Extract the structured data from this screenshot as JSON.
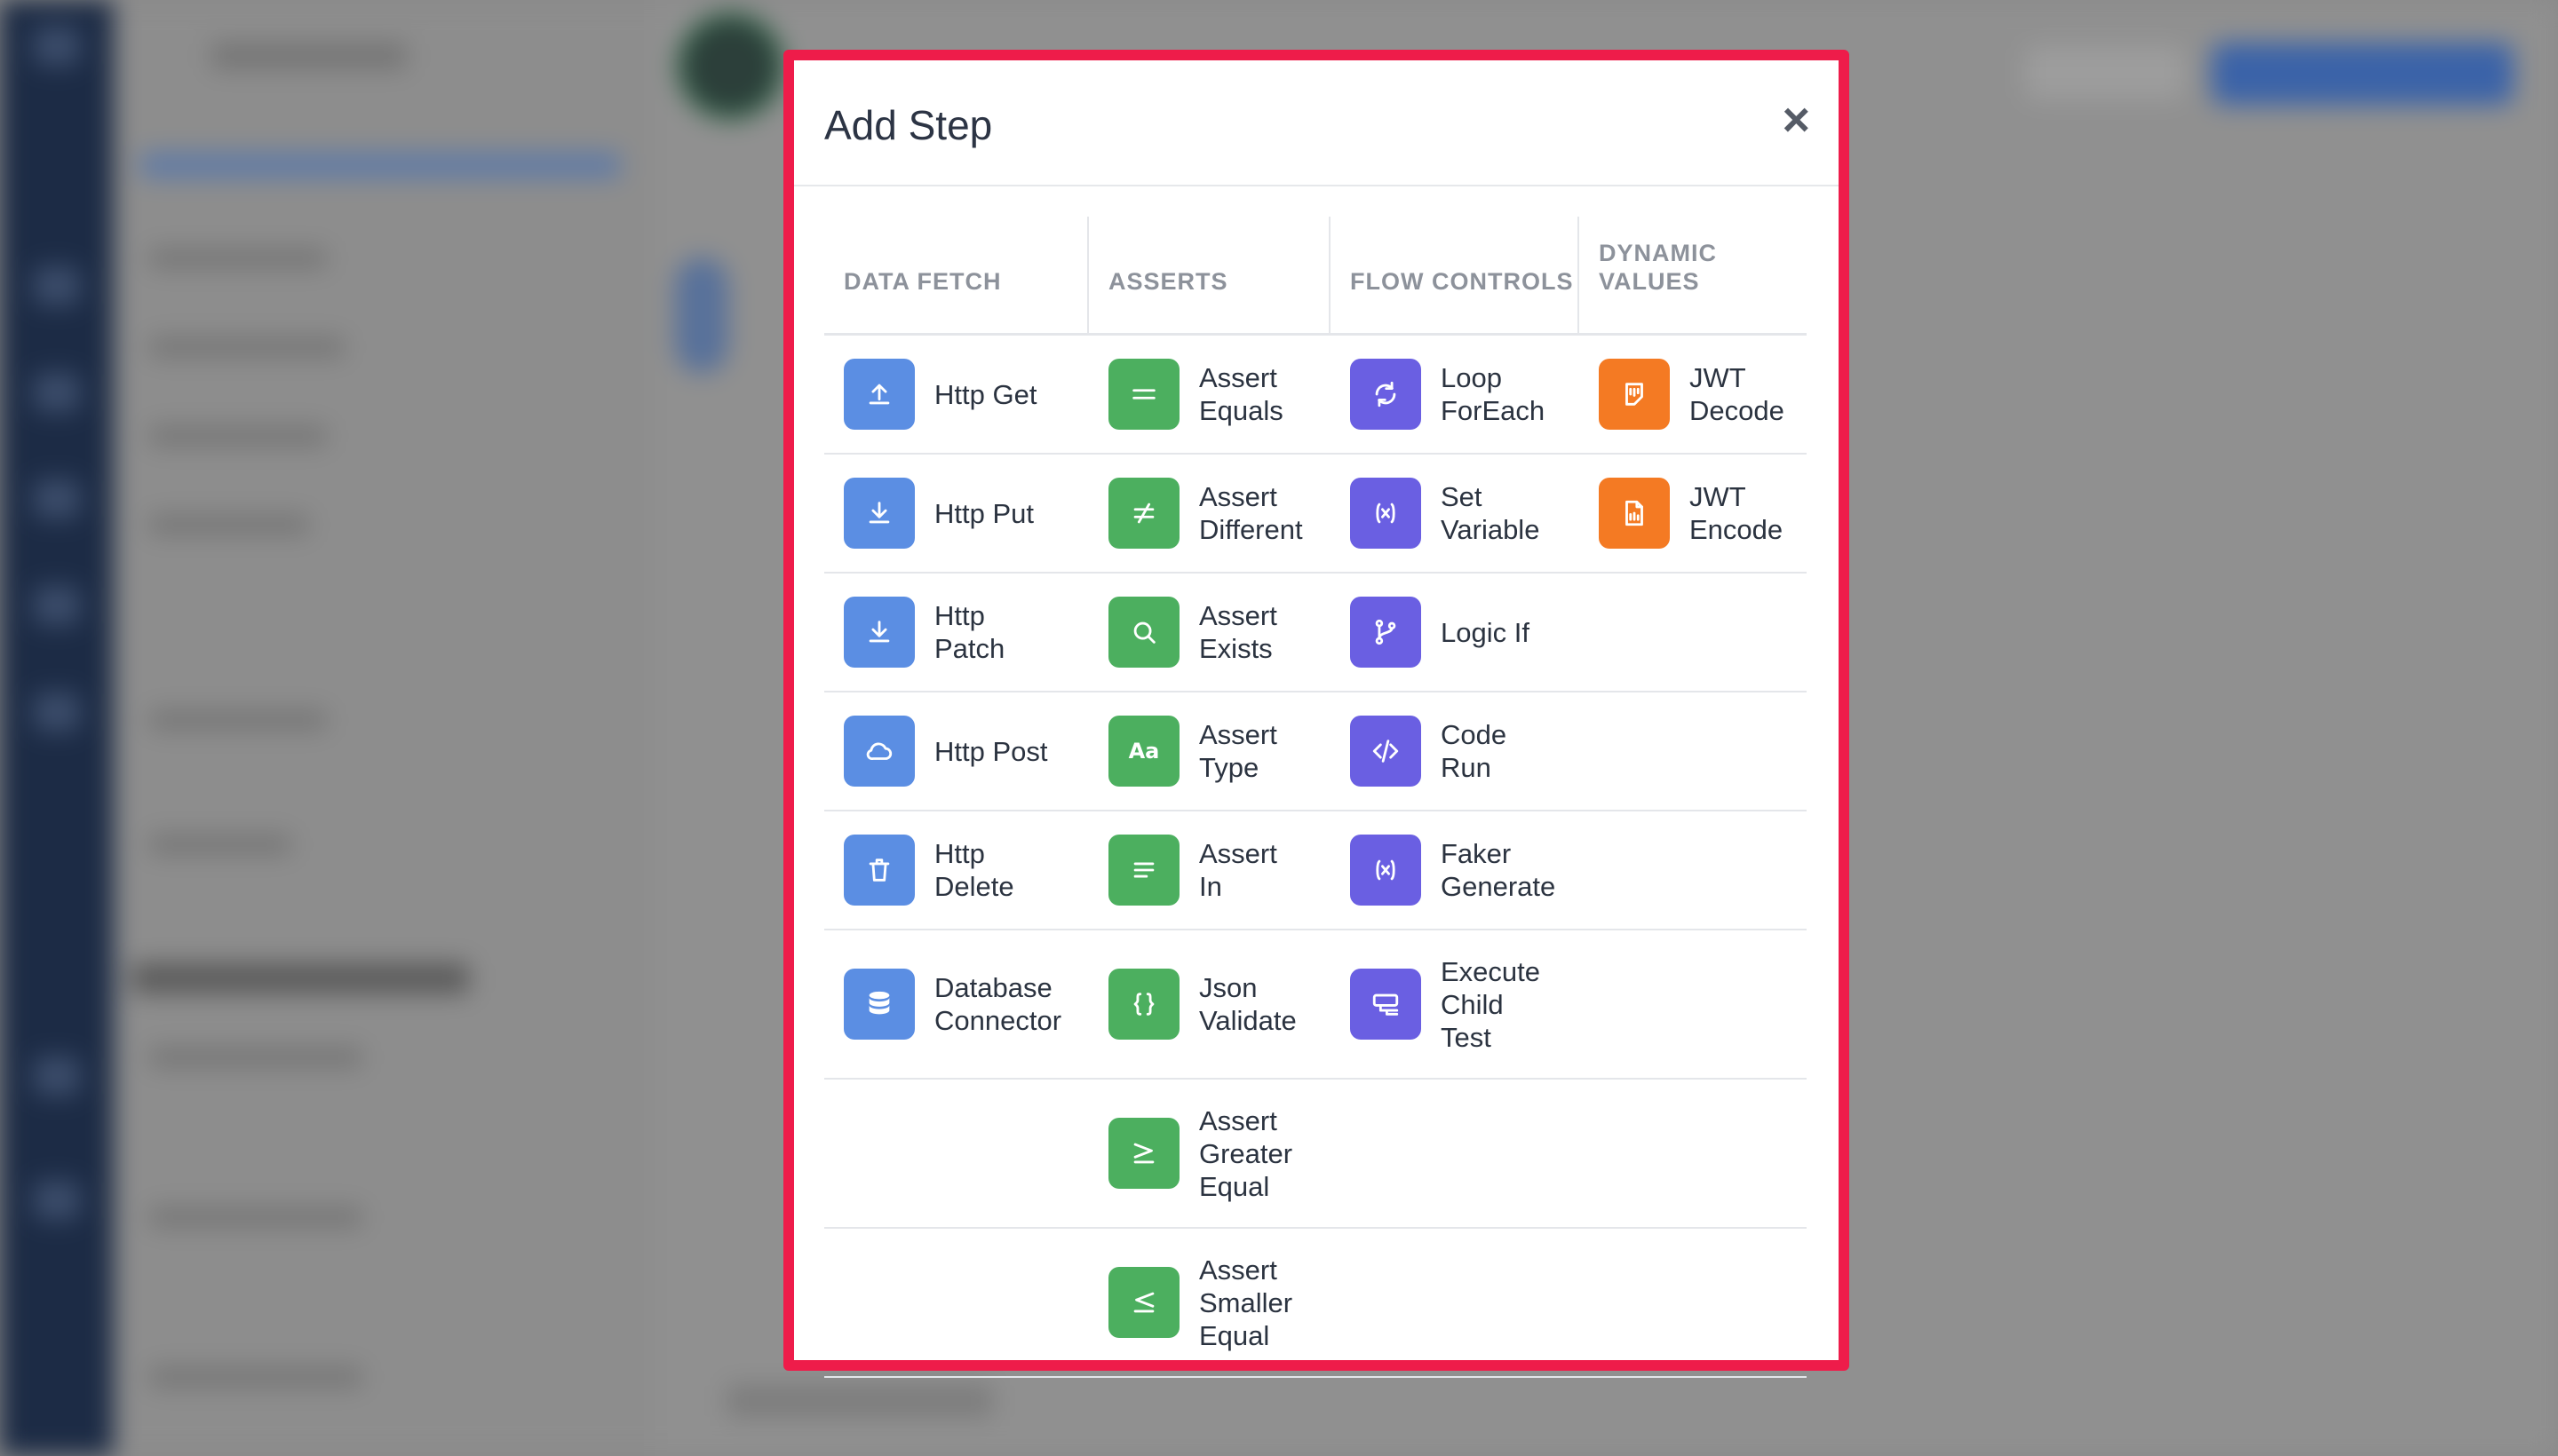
{
  "modal": {
    "title": "Add Step",
    "close_label": "×"
  },
  "columns": [
    "DATA FETCH",
    "ASSERTS",
    "FLOW CONTROLS",
    "DYNAMIC\nVALUES"
  ],
  "colors": {
    "data_fetch": "#5b8ee3",
    "asserts": "#4caf5f",
    "flow_controls": "#6a5fe2",
    "dynamic_values": "#f47a23",
    "modal_border": "#ee1c4a"
  },
  "rows": [
    [
      {
        "label": "Http Get",
        "icon": "upload-icon"
      },
      {
        "label": "Assert\nEquals",
        "icon": "equals-icon"
      },
      {
        "label": "Loop\nForEach",
        "icon": "refresh-icon"
      },
      {
        "label": "JWT\nDecode",
        "icon": "jwt-decode-icon"
      }
    ],
    [
      {
        "label": "Http Put",
        "icon": "download-icon"
      },
      {
        "label": "Assert\nDifferent",
        "icon": "not-equal-icon"
      },
      {
        "label": "Set\nVariable",
        "icon": "variable-icon"
      },
      {
        "label": "JWT\nEncode",
        "icon": "file-icon"
      }
    ],
    [
      {
        "label": "Http\nPatch",
        "icon": "download-icon"
      },
      {
        "label": "Assert\nExists",
        "icon": "search-icon"
      },
      {
        "label": "Logic If",
        "icon": "branch-icon"
      },
      null
    ],
    [
      {
        "label": "Http Post",
        "icon": "cloud-icon"
      },
      {
        "label": "Assert\nType",
        "icon": "type-icon"
      },
      {
        "label": "Code\nRun",
        "icon": "code-icon"
      },
      null
    ],
    [
      {
        "label": "Http\nDelete",
        "icon": "trash-icon"
      },
      {
        "label": "Assert\nIn",
        "icon": "list-icon"
      },
      {
        "label": "Faker\nGenerate",
        "icon": "variable-icon"
      },
      null
    ],
    [
      {
        "label": "Database\nConnector",
        "icon": "database-icon"
      },
      {
        "label": "Json\nValidate",
        "icon": "braces-icon"
      },
      {
        "label": "Execute\nChild\nTest",
        "icon": "child-test-icon"
      },
      null
    ],
    [
      null,
      {
        "label": "Assert\nGreater\nEqual",
        "icon": "greater-equal-icon"
      },
      null,
      null
    ],
    [
      null,
      {
        "label": "Assert\nSmaller\nEqual",
        "icon": "less-equal-icon"
      },
      null,
      null
    ]
  ]
}
